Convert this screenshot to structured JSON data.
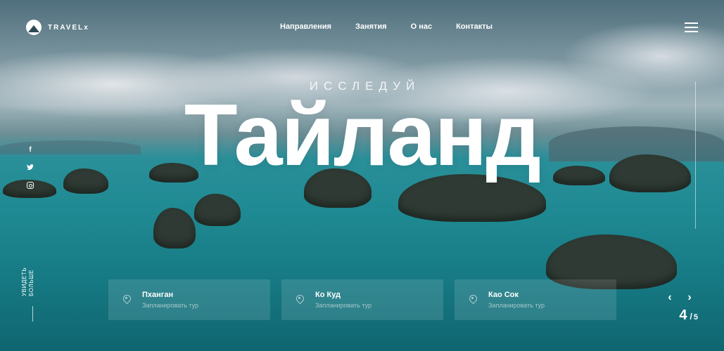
{
  "header": {
    "logo_text": "TRAVELx",
    "nav": [
      "Направления",
      "Занятия",
      "О нас",
      "Контакты"
    ]
  },
  "hero": {
    "eyebrow": "ИССЛЕДУЙ",
    "title": "Тайланд"
  },
  "side": {
    "see_more": "увидеть\nбольше",
    "social_icons": [
      "facebook-icon",
      "twitter-icon",
      "instagram-icon"
    ]
  },
  "cards": [
    {
      "title": "Пханган",
      "subtitle": "Запланировать тур"
    },
    {
      "title": "Ко Куд",
      "subtitle": "Запланировать тур"
    },
    {
      "title": "Као Сок",
      "subtitle": "Запланировать тур"
    }
  ],
  "slider": {
    "prev_icon": "chevron-left-icon",
    "next_icon": "chevron-right-icon",
    "current": "4",
    "separator": "/",
    "total": "5"
  },
  "colors": {
    "water": "#1f8a93",
    "text": "#ffffff"
  }
}
